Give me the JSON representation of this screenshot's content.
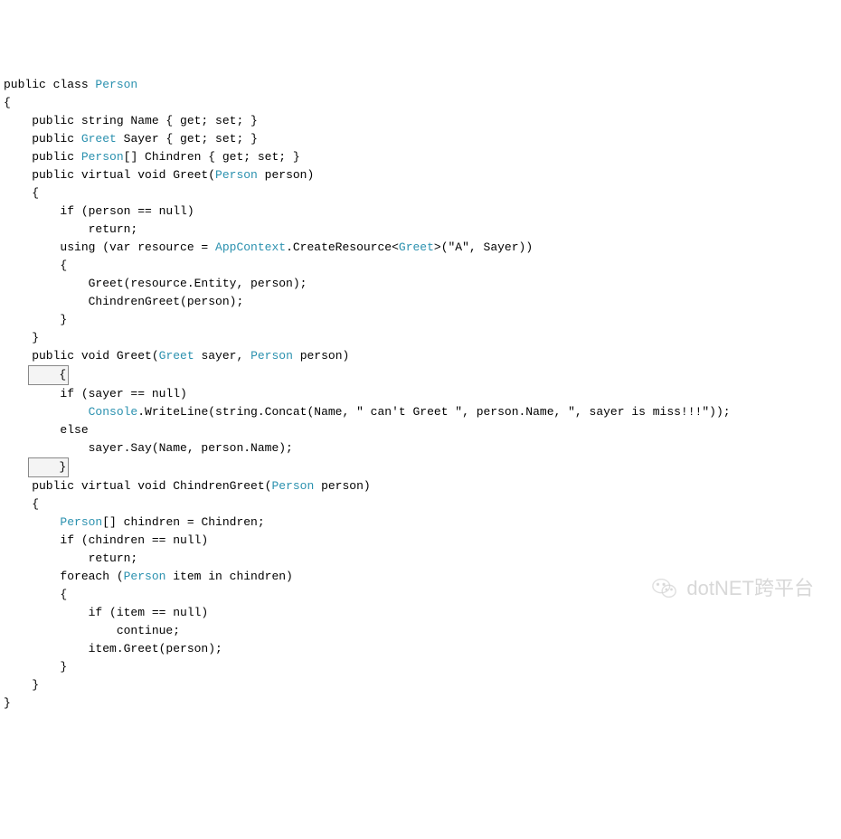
{
  "code": {
    "l01a": "public class ",
    "l01b": "Person",
    "l02": "{",
    "l03": "    public string Name { get; set; }",
    "l04a": "    public ",
    "l04b": "Greet",
    "l04c": " Sayer { get; set; }",
    "l05a": "    public ",
    "l05b": "Person",
    "l05c": "[] Chindren { get; set; }",
    "l06a": "    public virtual void Greet(",
    "l06b": "Person",
    "l06c": " person)",
    "l07": "    {",
    "l08": "        if (person == null)",
    "l09": "            return;",
    "l10a": "        using (var resource = ",
    "l10b": "AppContext",
    "l10c": ".CreateResource<",
    "l10d": "Greet",
    "l10e": ">(\"A\", Sayer))",
    "l11": "        {",
    "l12": "            Greet(resource.Entity, person);",
    "l13": "            ChindrenGreet(person);",
    "l14": "        }",
    "l15": "    }",
    "l16a": "    public void Greet(",
    "l16b": "Greet",
    "l16c": " sayer, ",
    "l16d": "Person",
    "l16e": " person)",
    "l17": "    {",
    "l18": "        if (sayer == null)",
    "l19a": "            ",
    "l19b": "Console",
    "l19c": ".WriteLine(string.Concat(Name, \" can't Greet \", person.Name, \", sayer is miss!!!\"));",
    "l20": "        else",
    "l21": "            sayer.Say(Name, person.Name);",
    "l22": "    }",
    "l23a": "    public virtual void ChindrenGreet(",
    "l23b": "Person",
    "l23c": " person)",
    "l24": "    {",
    "l25a": "        ",
    "l25b": "Person",
    "l25c": "[] chindren = Chindren;",
    "l26": "        if (chindren == null)",
    "l27": "            return;",
    "l28a": "        foreach (",
    "l28b": "Person",
    "l28c": " item in chindren)",
    "l29": "        {",
    "l30": "            if (item == null)",
    "l31": "                continue;",
    "l32": "            item.Greet(person);",
    "l33": "        }",
    "l34": "    }",
    "l35": "}"
  },
  "watermark": {
    "text": "dotNET跨平台"
  }
}
